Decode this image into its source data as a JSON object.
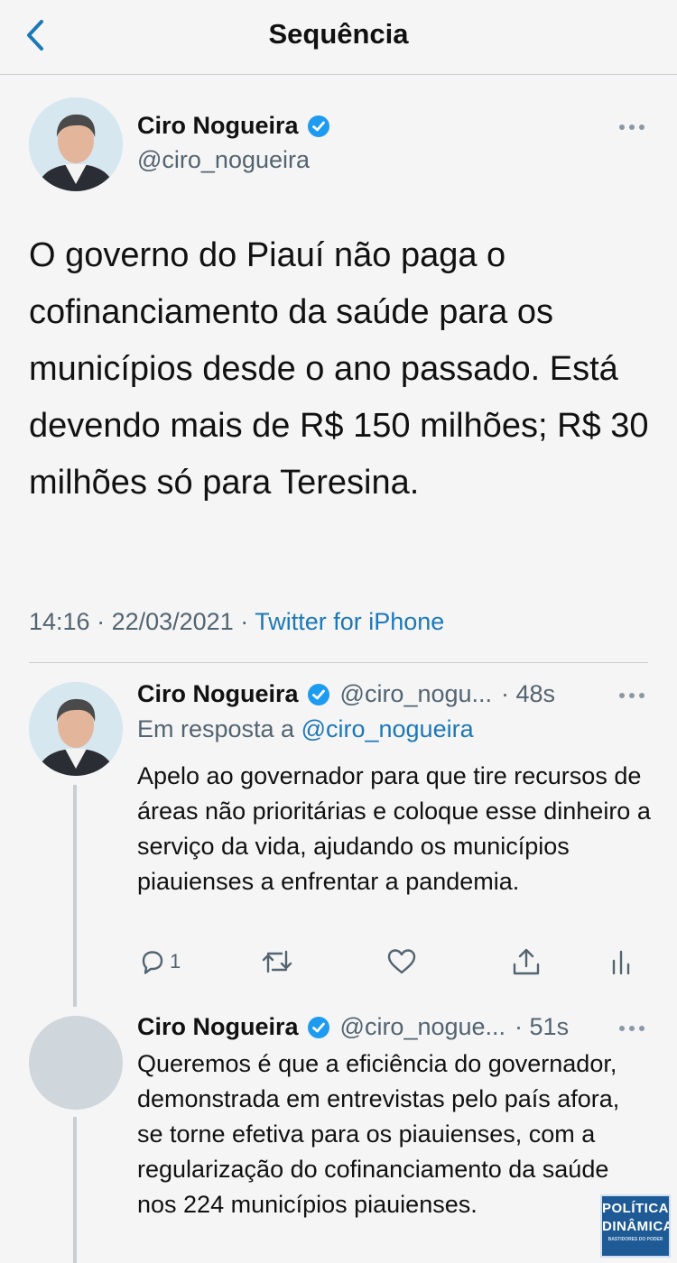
{
  "header": {
    "title": "Sequência"
  },
  "main_tweet": {
    "author_name": "Ciro Nogueira",
    "handle": "@ciro_nogueira",
    "text": "O governo do Piauí não paga o cofinanciamento da saúde para os municípios desde o ano passado. Está devendo mais de R$ 150 milhões; R$ 30 milhões só para Teresina.",
    "time": "14:16",
    "date": "22/03/2021",
    "separator": " · ",
    "client": "Twitter for iPhone"
  },
  "reply_1": {
    "author_name": "Ciro Nogueira",
    "handle": "@ciro_nogu...",
    "time": "· 48s",
    "reply_label": "Em resposta a ",
    "reply_mention": "@ciro_nogueira",
    "text": "Apelo ao governador para que tire recursos de áreas não prioritárias e coloque esse dinheiro a serviço da vida, ajudando os municípios piauienses a enfrentar a pandemia.",
    "reply_count": "1"
  },
  "reply_2": {
    "author_name": "Ciro Nogueira",
    "handle": "@ciro_nogue...",
    "time": "· 51s",
    "text": "Queremos é que a eficiência do governador, demonstrada em entrevistas pelo país afora, se torne efetiva para os piauienses, com a regularização do cofinanciamento da saúde nos 224 municípios piauienses."
  },
  "watermark": {
    "line1": "POLÍTICA",
    "line2": "DINÂMICA",
    "tagline": "BASTIDORES DO PODER"
  },
  "colors": {
    "link": "#1d78b8",
    "verified": "#1d9bf0",
    "secondary": "#536471",
    "background": "#f5f5f5"
  },
  "icons": [
    "back-chevron-icon",
    "verified-badge-icon",
    "more-icon",
    "reply-icon",
    "retweet-icon",
    "like-icon",
    "share-icon",
    "analytics-icon"
  ]
}
